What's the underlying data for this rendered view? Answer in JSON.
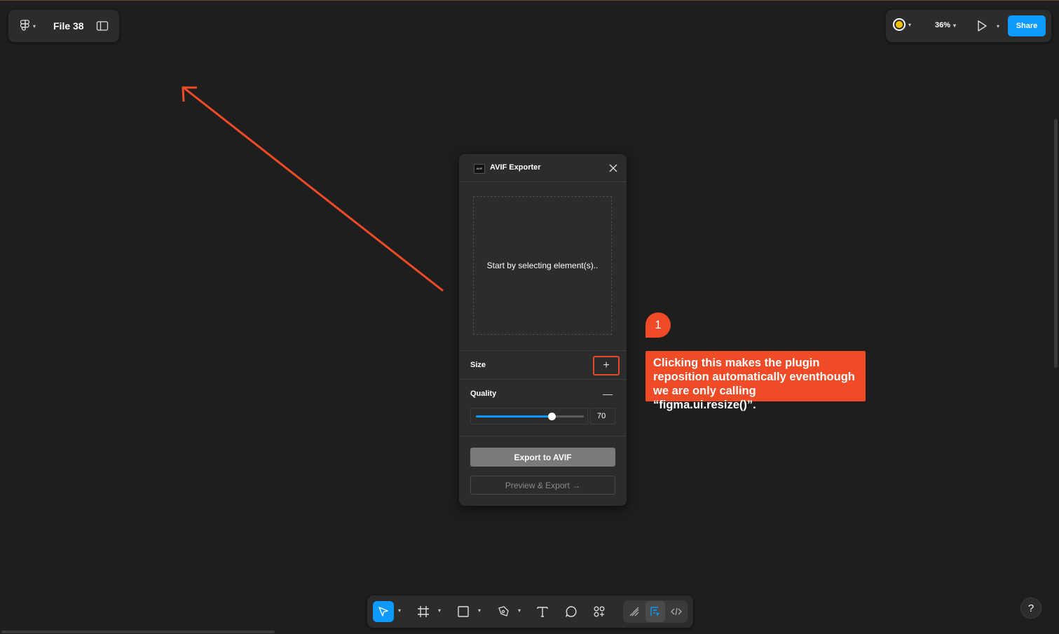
{
  "header": {
    "file_name": "File 38",
    "zoom_level": "36%",
    "share_label": "Share",
    "avatar_color": "#f2c200"
  },
  "plugin": {
    "title": "AVIF Exporter",
    "logo_text": "AVIF",
    "dropzone_text": "Start by selecting element(s)..",
    "size_label": "Size",
    "size_add_icon": "+",
    "quality_label": "Quality",
    "quality_collapse_icon": "—",
    "quality_value": "70",
    "quality_level": 0.7,
    "export_label": "Export to AVIF",
    "preview_label": "Preview & Export →"
  },
  "annotation": {
    "number": "1",
    "text": "Clicking this makes the plugin reposition automatically eventhough we are only calling “figma.ui.resize()”.",
    "color": "#f04a26"
  },
  "toolbar": {
    "tools": [
      "move-tool",
      "frame-tool",
      "shape-tool",
      "pen-tool",
      "text-tool",
      "comment-tool",
      "actions-tool"
    ],
    "modes": [
      "draw-mode",
      "design-mode",
      "dev-mode"
    ]
  },
  "help_label": "?",
  "accent_color": "#0d99ff"
}
